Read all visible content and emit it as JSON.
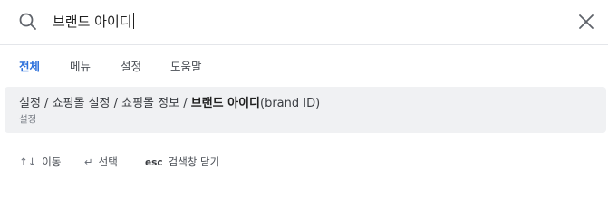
{
  "search": {
    "query": "브랜드 아이디",
    "icon": "search-icon"
  },
  "tabs": [
    {
      "label": "전체",
      "active": true
    },
    {
      "label": "메뉴",
      "active": false
    },
    {
      "label": "설정",
      "active": false
    },
    {
      "label": "도움말",
      "active": false
    }
  ],
  "results": [
    {
      "path_prefix": "설정 / 쇼핑몰 설정 / 쇼핑몰 정보 / ",
      "path_match": "브랜드 아이디",
      "path_suffix": "(brand ID)",
      "category": "설정"
    }
  ],
  "footer": {
    "move_key": "↑↓",
    "move_label": "이동",
    "select_key": "↵",
    "select_label": "선택",
    "close_key": "esc",
    "close_label": "검색창 닫기"
  },
  "colors": {
    "accent": "#2b6fdb",
    "result_bg": "#f0f1f3",
    "divider": "#e4e6ea"
  }
}
